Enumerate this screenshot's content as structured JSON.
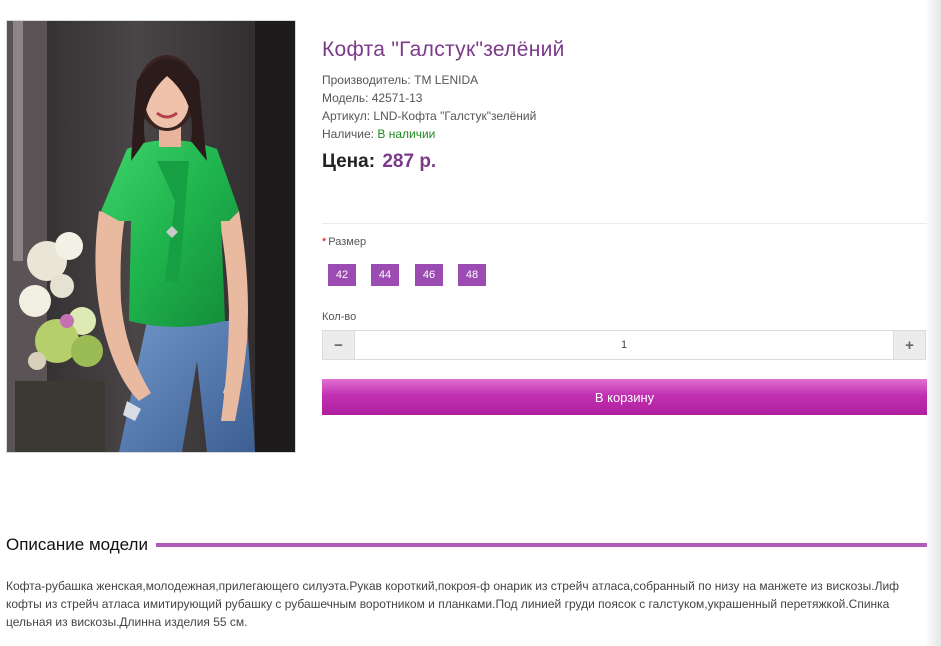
{
  "product": {
    "title": "Кофта \"Галстук\"зелёний",
    "manufacturer_label": "Производитель:",
    "manufacturer": "TM LENIDA",
    "model_label": "Модель:",
    "model": "42571-13",
    "sku_label": "Артикул:",
    "sku": "LND-Кофта \"Галстук\"зелёний",
    "availability_label": "Наличие:",
    "availability": "В наличии",
    "price_label": "Цена:",
    "price": "287 р."
  },
  "options": {
    "size_required_marker": "*",
    "size_label": "Размер",
    "sizes": [
      "42",
      "44",
      "46",
      "48"
    ]
  },
  "quantity": {
    "label": "Кол-во",
    "value": "1",
    "minus_icon": "minus-icon",
    "plus_icon": "plus-icon"
  },
  "cart": {
    "button_label": "В корзину"
  },
  "description": {
    "heading": "Описание модели",
    "text": "Кофта-рубашка женская,молодежная,прилегающего силуэта.Рукав короткий,покроя-ф онарик из стрейч атласа,собранный по низу на манжете из вискозы.Лиф кофты из стрейч атласа имитирующий рубашку с рубашечным воротником и планками.Под линией груди поясок с галстуком,украшенный перетяжкой.Спинка цельная из вискозы.Длинна изделия 55 см."
  },
  "colors": {
    "accent": "#7b3a8a",
    "size_button": "#9b4bb2",
    "cart_button": "#c030b0",
    "in_stock": "#1f8a1f",
    "heading_rule": "#b05ab9"
  }
}
